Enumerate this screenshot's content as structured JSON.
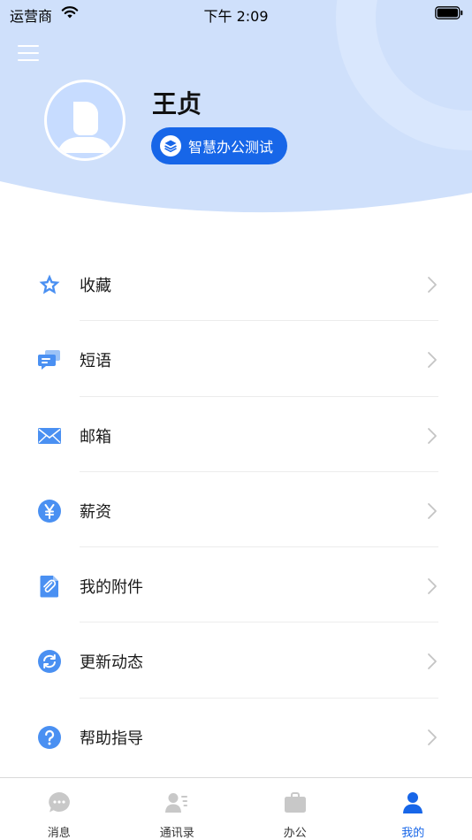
{
  "status_bar": {
    "carrier": "运营商",
    "time": "下午 2:09"
  },
  "profile": {
    "name": "王贞",
    "org_badge": "智慧办公测试"
  },
  "menu": [
    {
      "label": "收藏",
      "icon": "star-icon"
    },
    {
      "label": "短语",
      "icon": "chat-bubbles-icon"
    },
    {
      "label": "邮箱",
      "icon": "mail-icon"
    },
    {
      "label": "薪资",
      "icon": "yen-icon"
    },
    {
      "label": "我的附件",
      "icon": "paperclip-icon"
    },
    {
      "label": "更新动态",
      "icon": "refresh-icon"
    },
    {
      "label": "帮助指导",
      "icon": "help-icon"
    }
  ],
  "tab_bar": {
    "tabs": [
      {
        "label": "消息",
        "icon": "message-icon",
        "active": false
      },
      {
        "label": "通讯录",
        "icon": "contacts-icon",
        "active": false
      },
      {
        "label": "办公",
        "icon": "briefcase-icon",
        "active": false
      },
      {
        "label": "我的",
        "icon": "person-icon",
        "active": true
      }
    ]
  },
  "colors": {
    "accent": "#1766e8",
    "header_bg": "#cfe0fb",
    "icon_blue": "#4a90f2",
    "inactive_tab": "#c8c8c8"
  }
}
